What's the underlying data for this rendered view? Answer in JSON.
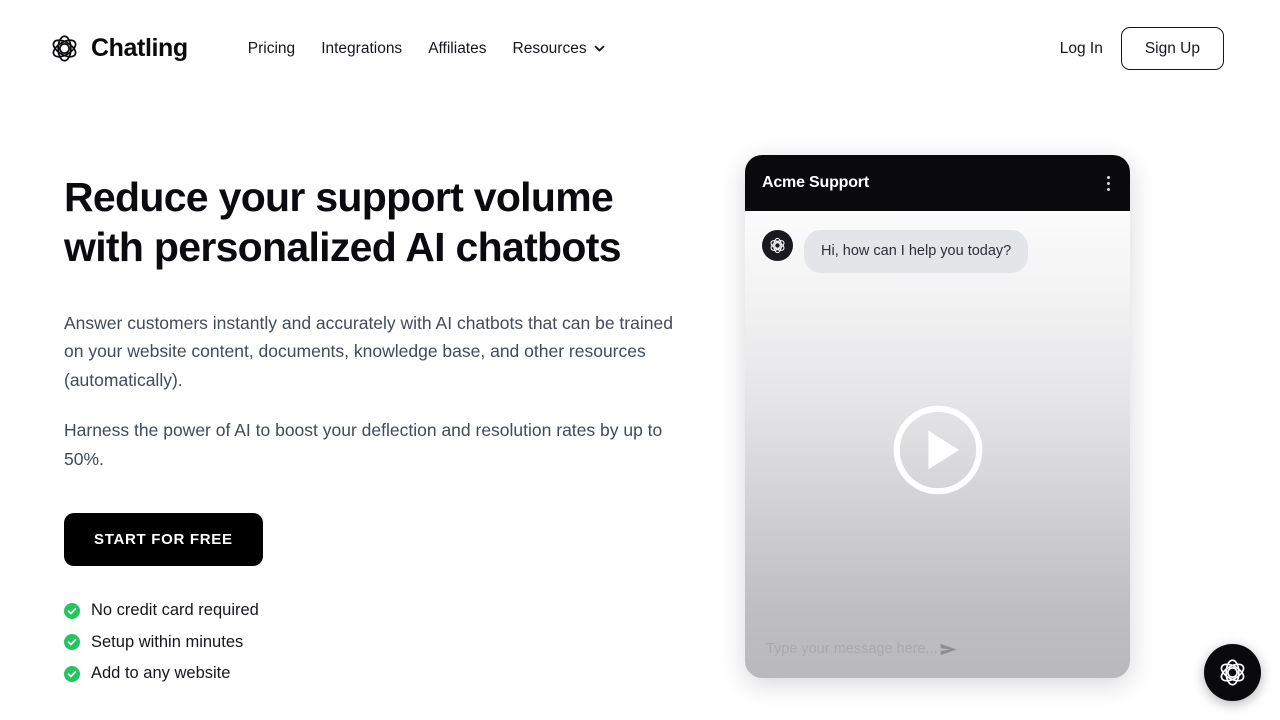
{
  "brand": {
    "name": "Chatling",
    "logo_icon": "atom-icon"
  },
  "nav": {
    "links": [
      {
        "label": "Pricing",
        "caret": false
      },
      {
        "label": "Integrations",
        "caret": false
      },
      {
        "label": "Affiliates",
        "caret": false
      },
      {
        "label": "Resources",
        "caret": true
      }
    ],
    "login_label": "Log In",
    "signup_label": "Sign Up"
  },
  "hero": {
    "title_line1": "Reduce your support volume",
    "title_line2": "with personalized AI chatbots",
    "paragraph1": "Answer customers instantly and accurately with AI chatbots that can be trained on your website content, documents, knowledge base, and other resources (automatically).",
    "paragraph2": "Harness the power of AI to boost your deflection and resolution rates by up to 50%.",
    "cta_label": "START FOR FREE",
    "checklist": [
      "No credit card required",
      "Setup within minutes",
      "Add to any website"
    ]
  },
  "chat_widget": {
    "header_title": "Acme Support",
    "menu_icon": "kebab-menu-icon",
    "avatar_icon": "atom-icon",
    "message": "Hi, how can I help you today?",
    "input_placeholder": "Type your message here...",
    "send_icon": "send-icon",
    "play_icon": "play-circle-icon"
  },
  "launcher": {
    "icon": "atom-icon"
  },
  "colors": {
    "ink": "#0b0b0f",
    "body_text": "#414a5b",
    "cta_bg": "#000000",
    "check_green": "#22c55e",
    "chat_header_bg": "#0a0a0c"
  }
}
